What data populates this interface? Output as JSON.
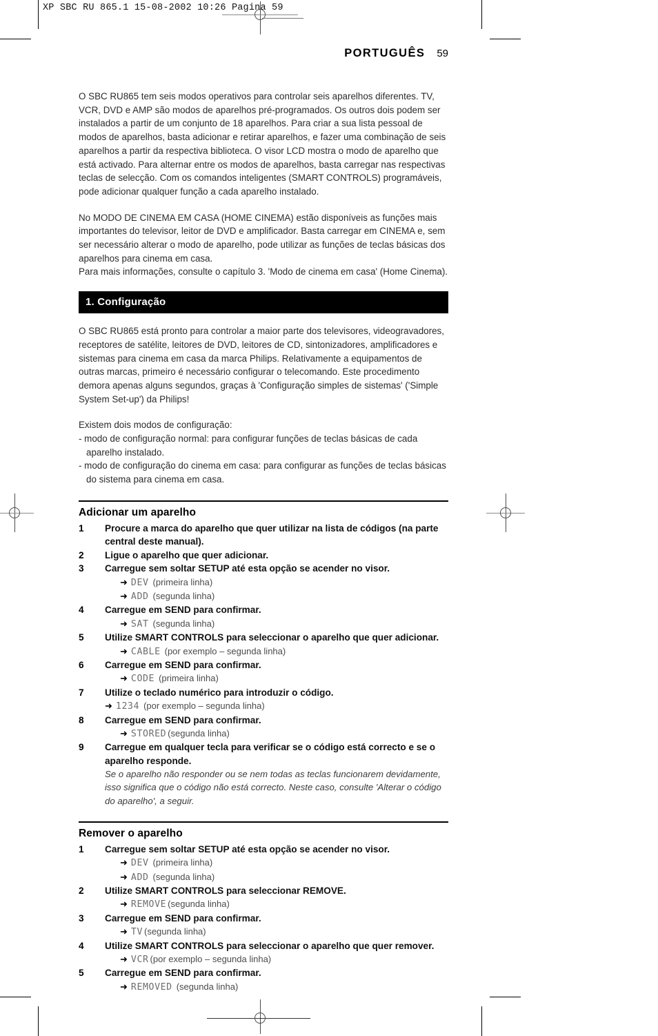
{
  "prepress": {
    "header": "XP SBC RU 865.1  15-08-2002 10:26  Pagina 59"
  },
  "running_head": {
    "language": "PORTUGUÊS",
    "page_number": "59"
  },
  "intro": {
    "paragraph_1": "O SBC RU865 tem seis modos operativos para controlar seis aparelhos diferentes. TV, VCR, DVD e AMP são modos de aparelhos pré-programados. Os outros dois podem ser instalados a partir de um conjunto de 18 aparelhos. Para criar a sua lista pessoal de modos de aparelhos, basta adicionar e retirar aparelhos, e fazer uma combinação de seis aparelhos a partir da respectiva biblioteca. O visor LCD mostra o modo de aparelho que está activado. Para alternar entre os modos de aparelhos, basta carregar nas respectivas teclas de selecção. Com os comandos inteligentes (SMART CONTROLS) programáveis, pode adicionar qualquer função a cada aparelho instalado.",
    "paragraph_2": "No MODO DE CINEMA EM CASA (HOME CINEMA) estão disponíveis as funções mais importantes do televisor, leitor de DVD e amplificador. Basta carregar em CINEMA e, sem ser necessário alterar o modo de aparelho, pode utilizar as funções de teclas básicas dos aparelhos para cinema em casa.",
    "paragraph_3": "Para mais informações, consulte o capítulo 3. 'Modo de cinema em casa' (Home Cinema)."
  },
  "section": {
    "bar_title": "1. Configuração",
    "paragraph": "O SBC RU865 está pronto para controlar a maior parte dos televisores, videogravadores, receptores de satélite, leitores de DVD, leitores de CD, sintonizadores, amplificadores e sistemas para cinema em casa da marca Philips. Relativamente a equipamentos de outras marcas, primeiro é necessário configurar o telecomando. Este procedimento demora apenas alguns segundos, graças à 'Configuração simples de sistemas' ('Simple System Set-up') da Philips!",
    "modes_lead": "Existem dois modos de configuração:",
    "modes": [
      "- modo de configuração normal: para configurar funções de teclas básicas de cada aparelho instalado.",
      "- modo de configuração do cinema em casa: para configurar as funções de teclas básicas do sistema para cinema em casa."
    ]
  },
  "add_device": {
    "heading": "Adicionar um aparelho",
    "steps": [
      {
        "num": "1",
        "text": "Procure a marca do aparelho que quer utilizar na lista de códigos (na parte central deste manual).",
        "results": []
      },
      {
        "num": "2",
        "text": "Ligue o aparelho que quer adicionar.",
        "results": []
      },
      {
        "num": "3",
        "text": "Carregue sem soltar SETUP até esta opção se acender no visor.",
        "results": [
          {
            "lcd": "DEV",
            "caption": "(primeira linha)"
          },
          {
            "lcd": "ADD",
            "caption": "(segunda linha)"
          }
        ]
      },
      {
        "num": "4",
        "text": "Carregue em SEND para confirmar.",
        "results": [
          {
            "lcd": "SAT",
            "caption": "(segunda linha)"
          }
        ]
      },
      {
        "num": "5",
        "text": "Utilize SMART CONTROLS para seleccionar o aparelho que quer adicionar.",
        "results": [
          {
            "lcd": "CABLE",
            "caption": "(por exemplo – segunda linha)"
          }
        ]
      },
      {
        "num": "6",
        "text": "Carregue em SEND para confirmar.",
        "results": [
          {
            "lcd": "CODE",
            "caption": "(primeira linha)"
          }
        ]
      },
      {
        "num": "7",
        "text": "Utilize o teclado numérico para introduzir o código.",
        "results": [
          {
            "lcd": "1234",
            "caption": "(por exemplo – segunda linha)"
          }
        ]
      },
      {
        "num": "8",
        "text": "Carregue em SEND para confirmar.",
        "results": [
          {
            "lcd": "STORED",
            "caption": "(segunda linha)"
          }
        ]
      },
      {
        "num": "9",
        "text": "Carregue em qualquer tecla para verificar se o código está correcto e se o aparelho responde.",
        "results": [],
        "note": "Se o aparelho não responder ou se nem todas as teclas funcionarem devidamente, isso significa que o código não está correcto. Neste caso, consulte 'Alterar o código do aparelho', a seguir."
      }
    ]
  },
  "remove_device": {
    "heading": "Remover o aparelho",
    "steps": [
      {
        "num": "1",
        "text": "Carregue sem soltar SETUP até esta opção se acender no visor.",
        "results": [
          {
            "lcd": "DEV",
            "caption": "(primeira linha)"
          },
          {
            "lcd": "ADD",
            "caption": "(segunda linha)"
          }
        ]
      },
      {
        "num": "2",
        "text": "Utilize SMART CONTROLS para seleccionar REMOVE.",
        "results": [
          {
            "lcd": "REMOVE",
            "caption": "(segunda linha)"
          }
        ]
      },
      {
        "num": "3",
        "text": "Carregue em SEND para confirmar.",
        "results": [
          {
            "lcd": "TV",
            "caption": "(segunda linha)"
          }
        ]
      },
      {
        "num": "4",
        "text": "Utilize SMART CONTROLS para seleccionar o aparelho que quer remover.",
        "results": [
          {
            "lcd": "VCR",
            "caption": "(por exemplo – segunda linha)"
          }
        ]
      },
      {
        "num": "5",
        "text": "Carregue em SEND para confirmar.",
        "results": [
          {
            "lcd": "REMOVED",
            "caption": "(segunda linha)"
          }
        ]
      }
    ]
  },
  "icons": {
    "arrow": "➜"
  },
  "colors": {
    "section_bar_bg": "#000000",
    "section_bar_text": "#ffffff",
    "body_text": "#2b2b2b",
    "lcd_text": "#6d6d6d"
  }
}
